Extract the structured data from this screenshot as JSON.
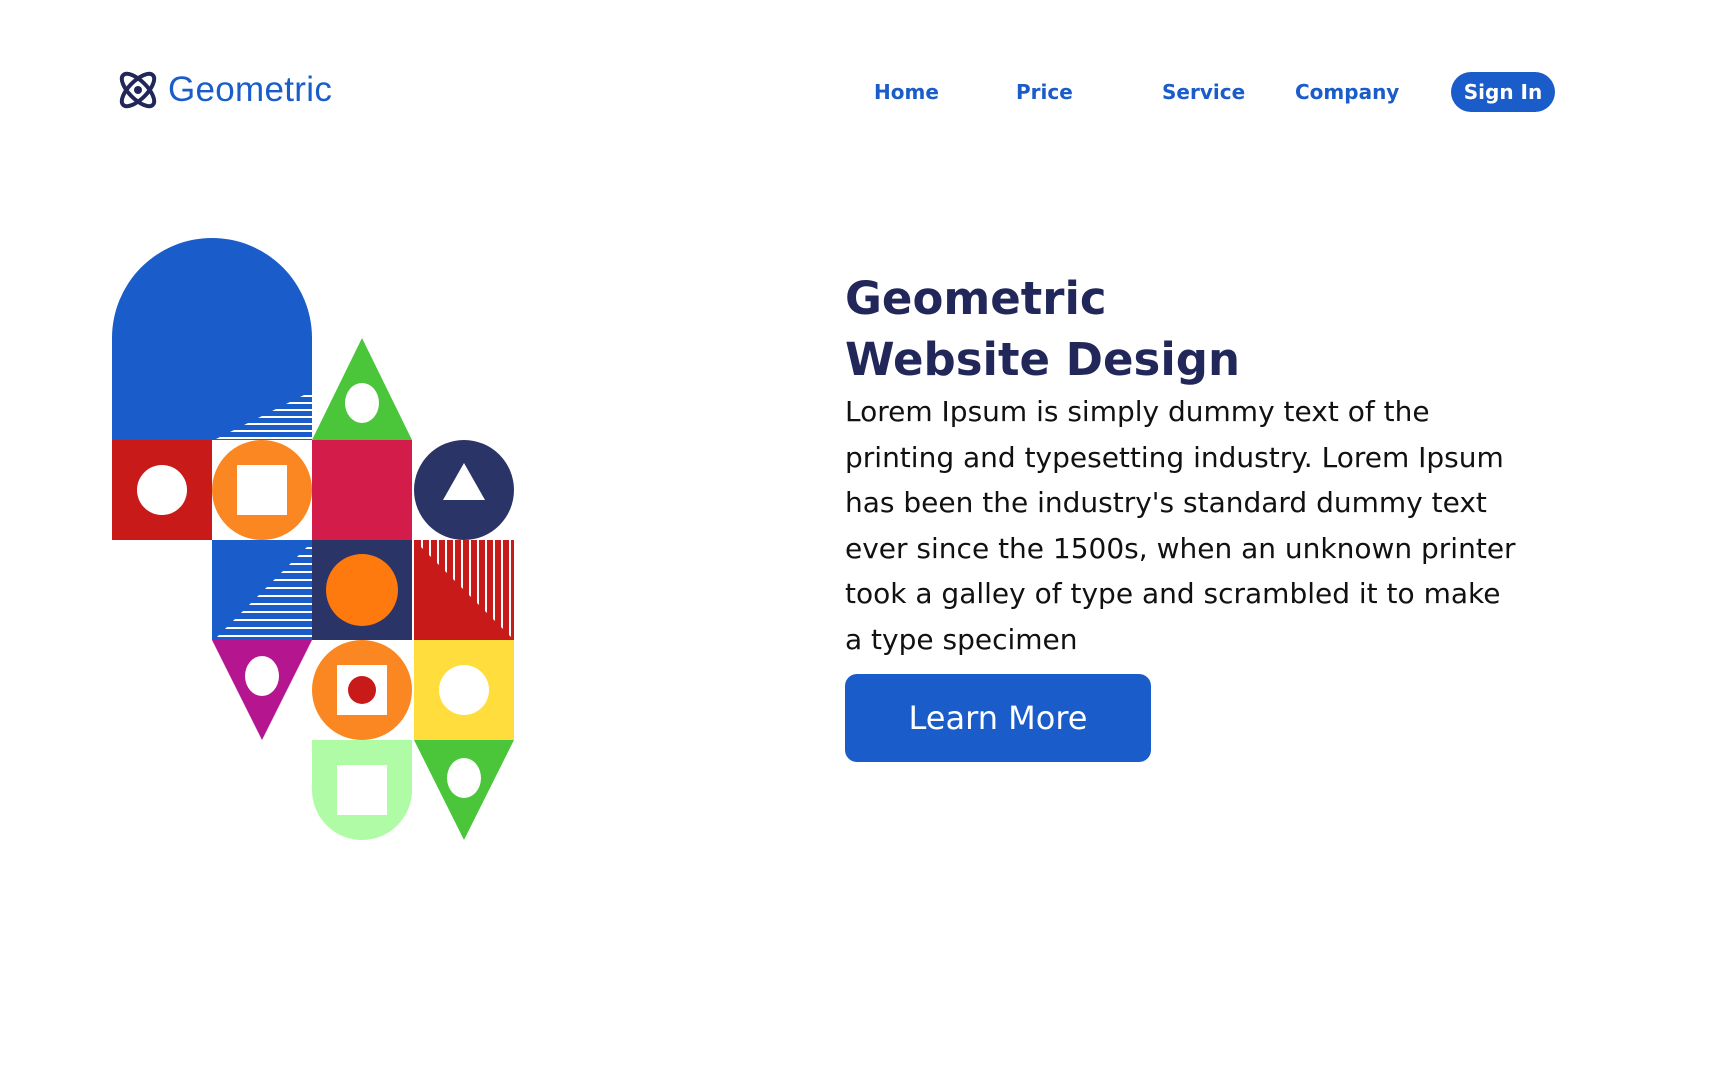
{
  "brand": {
    "logo_icon": "atom-orbit-icon",
    "name": "Geometric",
    "color": "#1a5cc9",
    "icon_color": "#22275a"
  },
  "nav": {
    "items": [
      {
        "label": "Home"
      },
      {
        "label": "Price"
      },
      {
        "label": "Service"
      },
      {
        "label": "Company"
      }
    ],
    "sign_in": "Sign In"
  },
  "hero": {
    "title_line_1": "Geometric",
    "title_line_2": "Website Design",
    "body_lines": [
      "Lorem Ipsum is simply dummy text of the",
      "printing and typesetting industry. Lorem Ipsum",
      "has been the industry's standard dummy text",
      "ever since the 1500s, when an unknown printer",
      "took a galley of type and scrambled it to make",
      "a type specimen"
    ],
    "cta_label": "Learn More"
  },
  "colors": {
    "primary_blue": "#1a5cc9",
    "navy": "#2b3467",
    "red": "#c91a1a",
    "crimson": "#d41c4b",
    "orange": "#fa8721",
    "green": "#4bc63b",
    "light_green": "#b0fba6",
    "yellow": "#ffdd3c",
    "magenta": "#b5168f",
    "text_dark": "#22275a"
  }
}
